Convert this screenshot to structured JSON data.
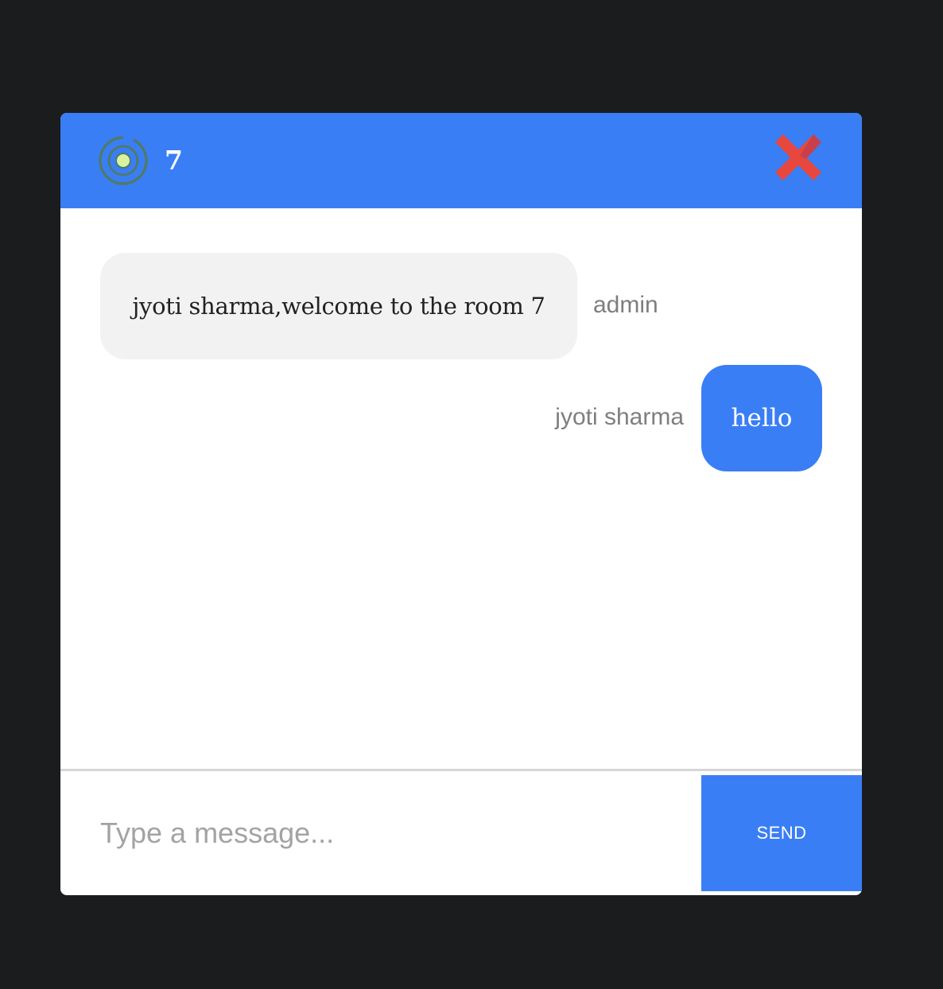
{
  "header": {
    "room_name": "7",
    "status_icon": "online-icon",
    "close_icon": "close-icon"
  },
  "messages": [
    {
      "direction": "received",
      "text": "jyoti sharma,welcome to the room 7",
      "sender": "admin"
    },
    {
      "direction": "sent",
      "text": "hello",
      "sender": "jyoti sharma"
    }
  ],
  "composer": {
    "placeholder": "Type a message...",
    "value": "",
    "send_label": "SEND"
  },
  "colors": {
    "accent": "#3a7ef5",
    "background": "#1b1c1e",
    "received_bubble": "#f2f2f2",
    "close_red": "#e8473d"
  }
}
